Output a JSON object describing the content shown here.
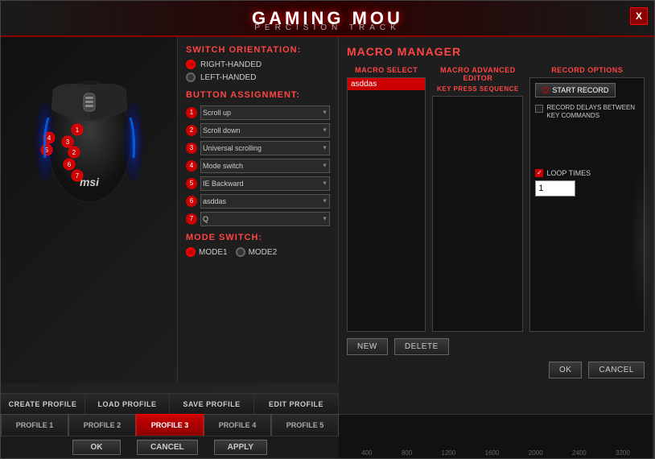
{
  "window": {
    "title": "GAMING MOU",
    "subtitle": "PERCISION TRACK",
    "close_btn": "X"
  },
  "switch_orientation": {
    "label": "SWITCH ORIENTATION:",
    "options": [
      "RIGHT-HANDED",
      "LEFT-HANDED"
    ],
    "selected": "RIGHT-HANDED"
  },
  "button_assignment": {
    "label": "BUTTON ASSIGNMENT:",
    "buttons": [
      {
        "number": "1",
        "value": "Scroll up"
      },
      {
        "number": "2",
        "value": "Scroll down"
      },
      {
        "number": "3",
        "value": "Universal scrolling"
      },
      {
        "number": "4",
        "value": "Mode switch"
      },
      {
        "number": "5",
        "value": "IE Backward"
      },
      {
        "number": "6",
        "value": "asddas"
      },
      {
        "number": "7",
        "value": "Q"
      }
    ]
  },
  "mode_switch": {
    "label": "MODE SWITCH:",
    "modes": [
      "MODE1",
      "MODE2"
    ]
  },
  "macro_manager": {
    "title": "MACRO MANAGER",
    "select_label": "MACRO SELECT",
    "editor_label": "MACRO ADVANCED EDITOR",
    "key_press_label": "KEY PRESS SEQUENCE",
    "record_options_label": "RECORD OPTIONS",
    "start_record_btn": "START RECORD",
    "record_delays_label": "RECORD DELAYS BETWEEN KEY COMMANDS",
    "loop_times_label": "LOOP TIMES",
    "loop_value": "1",
    "macro_items": [
      "asddas"
    ],
    "new_btn": "NEW",
    "delete_btn": "DELETE",
    "ok_btn": "OK",
    "cancel_btn": "CANCEL"
  },
  "toolbar": {
    "create_profile": "CREATE PROFILE",
    "load_profile": "LOAD PROFILE",
    "save_profile": "SAVE PROFILE",
    "edit_profile": "EDIT PROFILE"
  },
  "profiles": [
    {
      "label": "PROFILE 1",
      "active": false
    },
    {
      "label": "PROFILE 2",
      "active": false
    },
    {
      "label": "PROFILE 3",
      "active": true
    },
    {
      "label": "PROFILE 4",
      "active": false
    },
    {
      "label": "PROFILE 5",
      "active": false
    }
  ],
  "bottom_actions": {
    "ok": "OK",
    "cancel": "CANCEL",
    "apply": "APPLY"
  },
  "graph_labels": [
    "400",
    "800",
    "1200",
    "1600",
    "2000",
    "2400",
    "3200"
  ]
}
